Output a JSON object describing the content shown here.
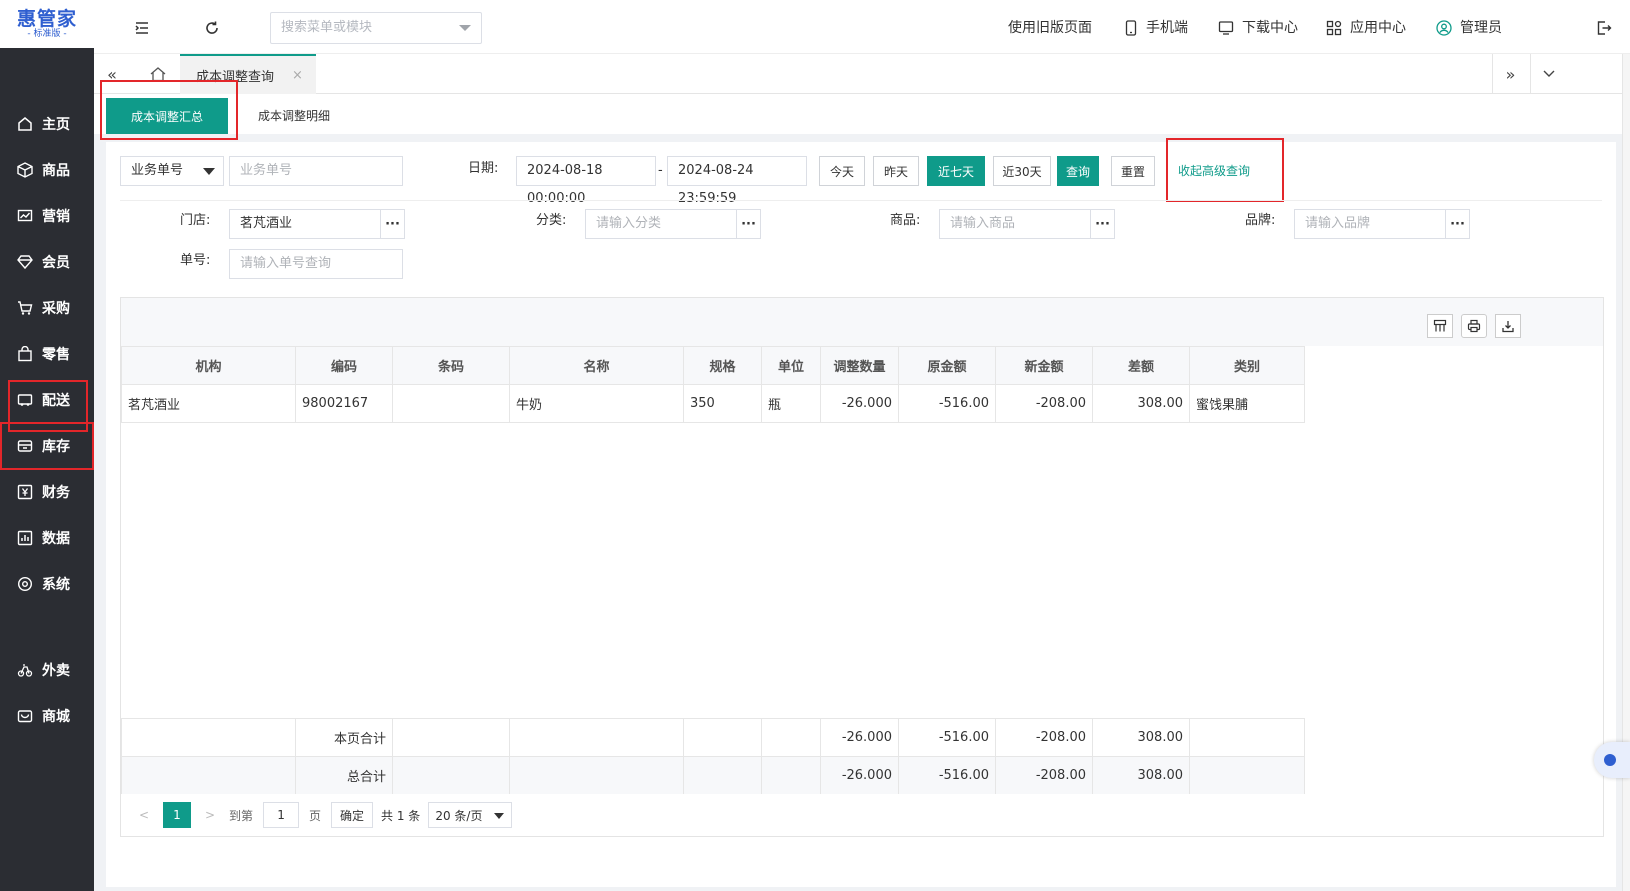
{
  "logo": {
    "main": "惠管家",
    "sub": "- 标准版 -"
  },
  "sidebar": {
    "items": [
      {
        "label": "主页",
        "icon": "home-icon"
      },
      {
        "label": "商品",
        "icon": "box-icon"
      },
      {
        "label": "营销",
        "icon": "chart-icon"
      },
      {
        "label": "会员",
        "icon": "diamond-icon"
      },
      {
        "label": "采购",
        "icon": "cart-icon"
      },
      {
        "label": "零售",
        "icon": "bag-icon"
      },
      {
        "label": "配送",
        "icon": "truck-icon"
      },
      {
        "label": "库存",
        "icon": "warehouse-icon"
      },
      {
        "label": "财务",
        "icon": "yen-icon"
      },
      {
        "label": "数据",
        "icon": "data-icon"
      },
      {
        "label": "系统",
        "icon": "settings-icon"
      },
      {
        "label": "外卖",
        "icon": "bike-icon"
      },
      {
        "label": "商城",
        "icon": "mall-icon"
      }
    ],
    "active": "库存"
  },
  "topbar": {
    "search_placeholder": "搜索菜单或模块",
    "old_page": "使用旧版页面",
    "mobile": "手机端",
    "download": "下载中心",
    "apps": "应用中心",
    "user": "管理员"
  },
  "tabs": {
    "active_label": "成本调整查询",
    "close": "×"
  },
  "subtabs": {
    "summary": "成本调整汇总",
    "detail": "成本调整明细"
  },
  "filters": {
    "type_select": "业务单号",
    "bizno_placeholder": "业务单号",
    "date_label": "日期:",
    "date_from": "2024-08-18 00:00:00",
    "date_sep": "-",
    "date_to": "2024-08-24 23:59:59",
    "btn_today": "今天",
    "btn_yesterday": "昨天",
    "btn_7days": "近七天",
    "btn_30days": "近30天",
    "btn_query": "查询",
    "btn_reset": "重置",
    "advanced_link": "收起高级查询",
    "store_label": "门店:",
    "store_value": "茗芃酒业",
    "category_label": "分类:",
    "category_placeholder": "请输入分类",
    "product_label": "商品:",
    "product_placeholder": "请输入商品",
    "brand_label": "品牌:",
    "brand_placeholder": "请输入品牌",
    "orderno_label": "单号:",
    "orderno_placeholder": "请输入单号查询",
    "more": "···"
  },
  "table": {
    "columns": [
      "机构",
      "编码",
      "条码",
      "名称",
      "规格",
      "单位",
      "调整数量",
      "原金额",
      "新金额",
      "差额",
      "类别"
    ],
    "rows": [
      {
        "org": "茗芃酒业",
        "code": "98002167",
        "barcode": "",
        "name": "牛奶",
        "spec": "350",
        "unit": "瓶",
        "qty": "-26.000",
        "old_amt": "-516.00",
        "new_amt": "-208.00",
        "diff": "308.00",
        "category": "蜜饯果脯"
      }
    ],
    "page_total": {
      "label": "本页合计",
      "qty": "-26.000",
      "old_amt": "-516.00",
      "new_amt": "-208.00",
      "diff": "308.00"
    },
    "grand_total": {
      "label": "总合计",
      "qty": "-26.000",
      "old_amt": "-516.00",
      "new_amt": "-208.00",
      "diff": "308.00"
    }
  },
  "pager": {
    "current": "1",
    "goto_label": "到第",
    "goto_value": "1",
    "page_label": "页",
    "ok": "确定",
    "total": "共 1 条",
    "page_size": "20 条/页"
  },
  "colors": {
    "primary": "#0f9b8a",
    "sidebar": "#2b2d33",
    "highlight": "#e3262a"
  }
}
